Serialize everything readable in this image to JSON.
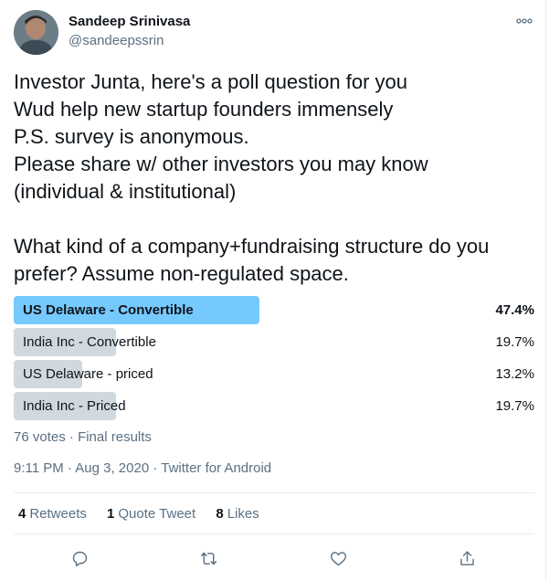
{
  "author": {
    "name": "Sandeep Srinivasa",
    "handle": "@sandeepssrin",
    "avatar_icon": "user-avatar"
  },
  "tweet": {
    "lines": [
      "Investor Junta, here's a poll question for you",
      "Wud help new startup founders immensely",
      "P.S. survey is anonymous.",
      "Please share w/ other investors you may know",
      "(individual & institutional)",
      "",
      "What kind of a company+fundraising structure do you",
      "prefer? Assume non-regulated space."
    ]
  },
  "poll": {
    "options": [
      {
        "label": "US Delaware - Convertible",
        "percent_text": "47.4%",
        "percent": 47.4,
        "winner": true
      },
      {
        "label": "India Inc - Convertible",
        "percent_text": "19.7%",
        "percent": 19.7,
        "winner": false
      },
      {
        "label": "US Delaware - priced",
        "percent_text": "13.2%",
        "percent": 13.2,
        "winner": false
      },
      {
        "label": "India Inc - Priced",
        "percent_text": "19.7%",
        "percent": 19.7,
        "winner": false
      }
    ],
    "votes": "76 votes",
    "separator": "·",
    "status": "Final results"
  },
  "meta": {
    "time": "9:11 PM",
    "date": "Aug 3, 2020",
    "source": "Twitter for Android",
    "separator": "·"
  },
  "stats": {
    "retweets_count": "4",
    "retweets_label": "Retweets",
    "quotes_count": "1",
    "quotes_label": "Quote Tweet",
    "likes_count": "8",
    "likes_label": "Likes"
  },
  "colors": {
    "winner_bar": "#76c9ff",
    "other_bar": "#cfd9de",
    "secondary_text": "#5b7083",
    "icon": "#5b7083"
  },
  "icons": [
    "more-icon",
    "reply-icon",
    "retweet-icon",
    "like-icon",
    "share-icon"
  ]
}
